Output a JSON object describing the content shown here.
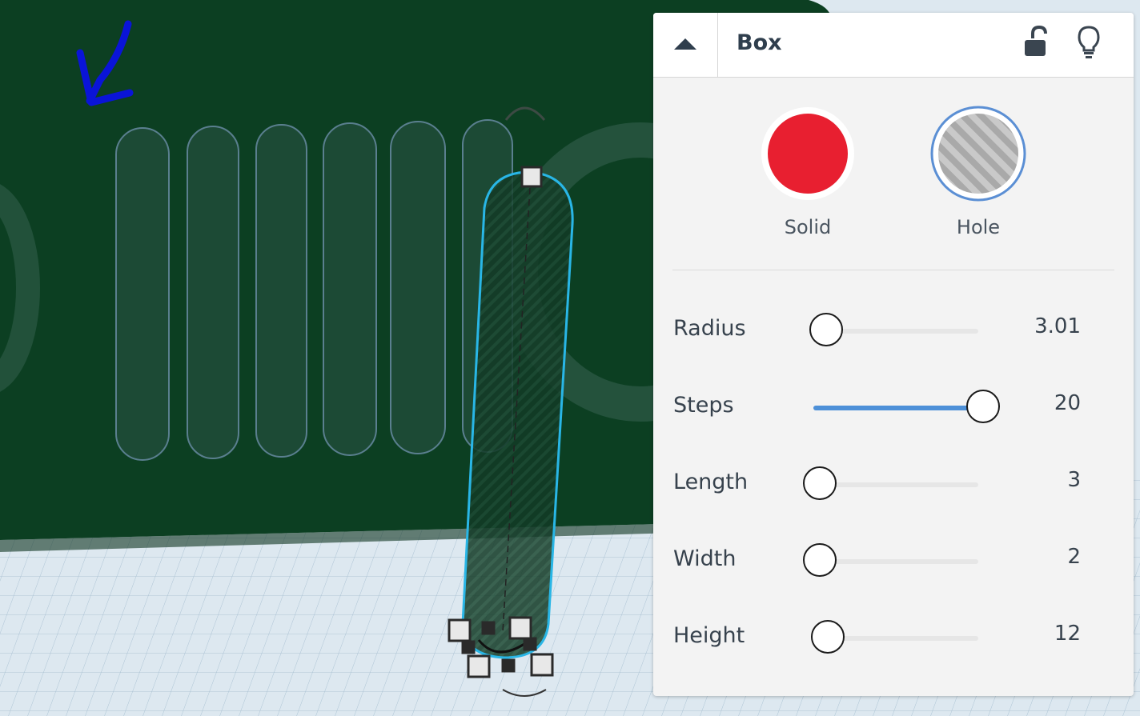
{
  "inspector": {
    "title": "Box",
    "icons": {
      "collapse": "caret-up-icon",
      "lock": "unlock-icon",
      "hint": "lightbulb-icon"
    },
    "modes": [
      {
        "label": "Solid",
        "color": "#e81f30"
      },
      {
        "label": "Hole",
        "color": "#b5b5b5",
        "ring_color": "#5b8fd4"
      }
    ],
    "params": [
      {
        "label": "Radius",
        "value": "3.01",
        "level": 0.04
      },
      {
        "label": "Steps",
        "value": "20",
        "level": 1.0
      },
      {
        "label": "Length",
        "value": "3",
        "level": 0.0
      },
      {
        "label": "Width",
        "value": "2",
        "level": 0.0
      },
      {
        "label": "Height",
        "value": "12",
        "level": 0.05
      }
    ]
  },
  "colors": {
    "green_body": "#0c3f22",
    "selection": "#29b6e6",
    "slider_fill": "#4d90d8",
    "annotation": "#0a14d8"
  }
}
